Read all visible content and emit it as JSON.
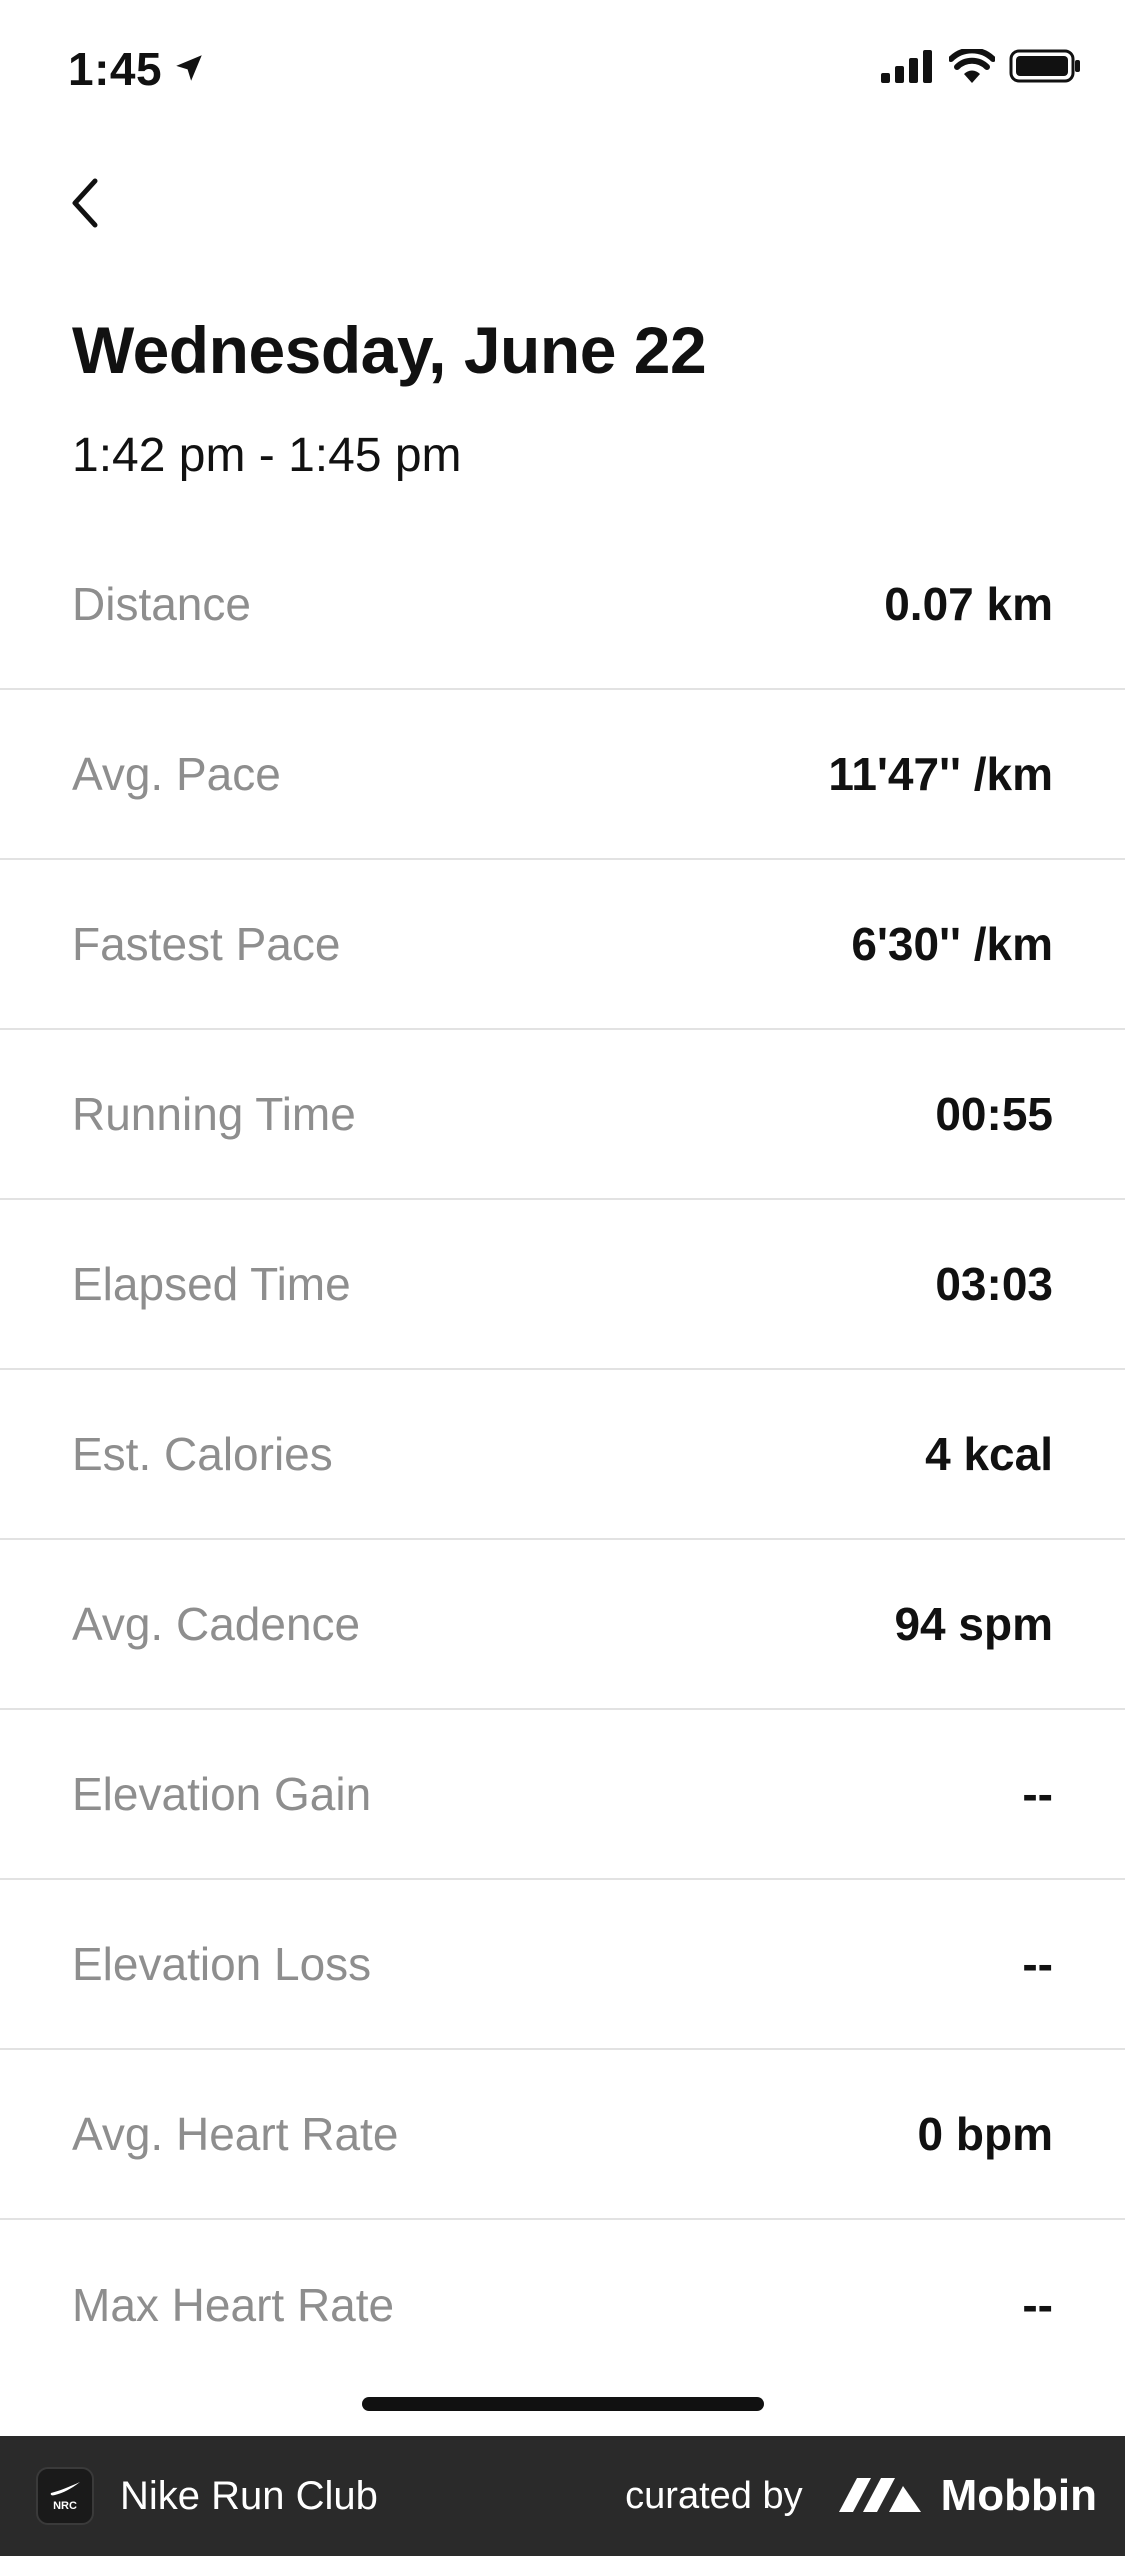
{
  "status_bar": {
    "time": "1:45"
  },
  "header": {
    "title": "Wednesday, June 22",
    "time_range": "1:42 pm - 1:45 pm"
  },
  "stats": [
    {
      "label": "Distance",
      "value": "0.07 km"
    },
    {
      "label": "Avg. Pace",
      "value": "11'47'' /km"
    },
    {
      "label": "Fastest Pace",
      "value": "6'30'' /km"
    },
    {
      "label": "Running Time",
      "value": "00:55"
    },
    {
      "label": "Elapsed Time",
      "value": "03:03"
    },
    {
      "label": "Est. Calories",
      "value": "4 kcal"
    },
    {
      "label": "Avg. Cadence",
      "value": "94 spm"
    },
    {
      "label": "Elevation Gain",
      "value": "--"
    },
    {
      "label": "Elevation Loss",
      "value": "--"
    },
    {
      "label": "Avg. Heart Rate",
      "value": "0 bpm"
    },
    {
      "label": "Max Heart Rate",
      "value": "--"
    }
  ],
  "footer": {
    "app_name": "Nike Run Club",
    "curated_by": "curated by",
    "brand": "Mobbin"
  },
  "icons": {
    "location": "location-arrow-icon",
    "signal": "cellular-signal-icon",
    "wifi": "wifi-icon",
    "battery": "battery-icon",
    "back": "chevron-left-icon",
    "app": "nrc-app-icon",
    "brand_logo": "mobbin-logo-icon"
  },
  "colors": {
    "label_gray": "#8e8e8e",
    "value_black": "#111111",
    "divider": "#e2e2e2",
    "footer_bg": "#2a2a2a"
  }
}
